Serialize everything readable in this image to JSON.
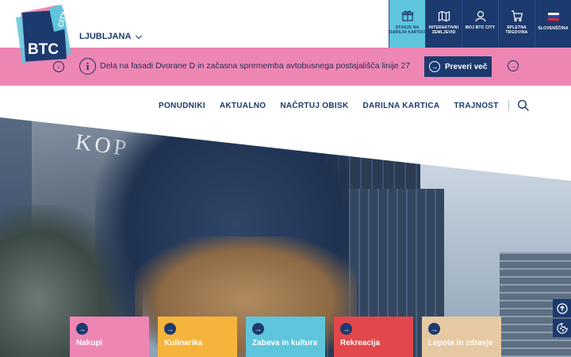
{
  "header": {
    "logo_alt": "BTC City",
    "city": "LJUBLJANA"
  },
  "utility": [
    {
      "label": "STANJE NA DARILNI KARTICI",
      "icon": "gift-icon",
      "active": true
    },
    {
      "label": "INTERAKTIVNI ZEMLJEVID",
      "icon": "map-icon",
      "active": false
    },
    {
      "label": "MOJ BTC CITY",
      "icon": "user-icon",
      "active": false
    },
    {
      "label": "SPLETNA TRGOVINA",
      "icon": "cart-icon",
      "active": false
    },
    {
      "label": "SLOVENŠČINA",
      "icon": "flag-slovenia-icon",
      "active": false
    }
  ],
  "alert": {
    "text": "Dela na fasadi Dvorane D in začasna sprememba avtobusnega postajališča linije 27",
    "button": "Preveri več"
  },
  "nav": [
    "PONUDNIKI",
    "AKTUALNO",
    "NAČRTUJ OBISK",
    "DARILNA KARTICA",
    "TRAJNOST"
  ],
  "tiles": [
    {
      "label": "Nakupi",
      "color": "#ee86b4"
    },
    {
      "label": "Kulinarika",
      "color": "#f5b43c"
    },
    {
      "label": "Zabava in kultura",
      "color": "#5fc5dc"
    },
    {
      "label": "Rekreacija",
      "color": "#e2474b"
    },
    {
      "label": "Lepota in zdravje",
      "color": "#e6c9a3"
    }
  ],
  "colors": {
    "brand_navy": "#1c3a6e",
    "accent_cyan": "#5fc5dc",
    "alert_pink": "#ee86b4"
  }
}
